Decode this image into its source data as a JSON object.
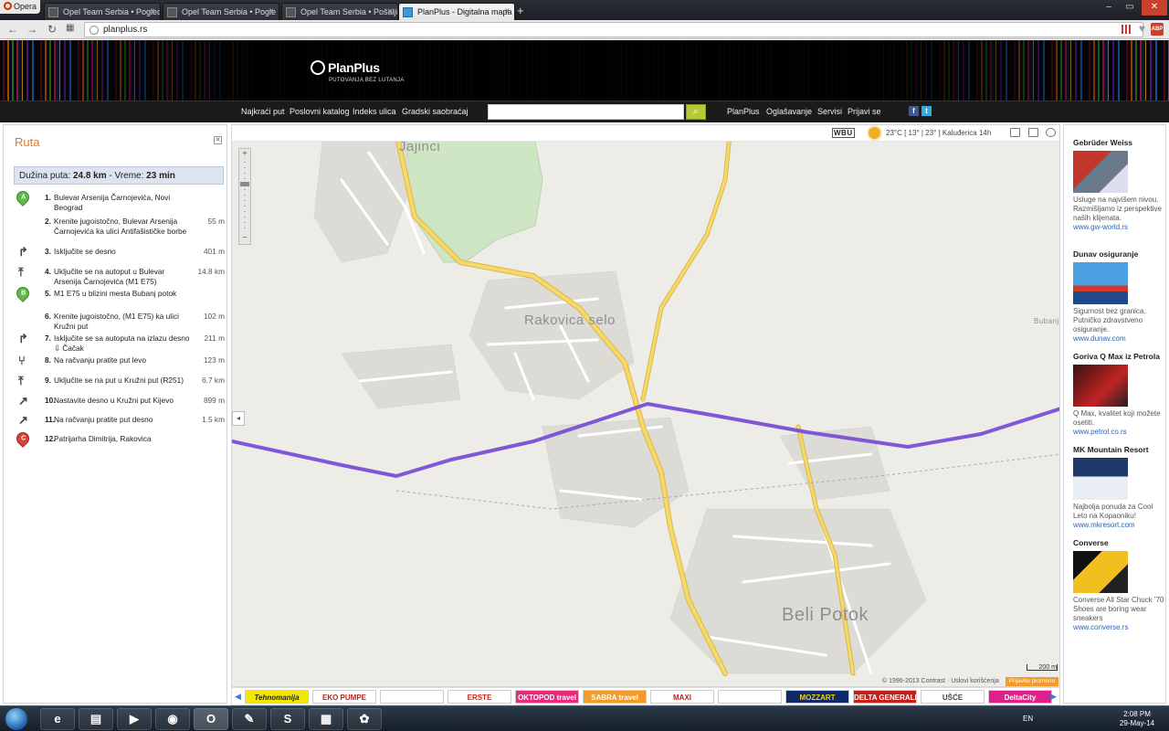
{
  "browser": {
    "menu_label": "Opera",
    "tabs": [
      {
        "label": "Opel Team Serbia • Poglec"
      },
      {
        "label": "Opel Team Serbia • Pogle"
      },
      {
        "label": "Opel Team Serbia • Pošalji"
      },
      {
        "label": "PlanPlus - Digitalna mapa"
      }
    ],
    "url": "planplus.rs",
    "adblock_label": "ABP"
  },
  "site": {
    "logo_name": "PlanPlus",
    "logo_tagline": "PUTOVANJA BEZ LUTANJA",
    "nav_left": [
      "Najkraći put",
      "Poslovni katalog",
      "Indeks ulica",
      "Gradski saobraćaj"
    ],
    "search_value": "",
    "nav_right": [
      "PlanPlus",
      "Oglašavanje",
      "Servisi",
      "Prijavi se"
    ]
  },
  "route": {
    "title": "Ruta",
    "summary_prefix": "Dužina puta:",
    "summary_length": "24.8 km",
    "summary_mid": "- Vreme:",
    "summary_time": "23 min",
    "steps": [
      {
        "num": "1.",
        "text": "Bulevar Arsenija Čarnojevića, Novi Beograd",
        "dist": "",
        "icon": "A"
      },
      {
        "num": "2.",
        "text": "Krenite jugoistočno, Bulevar Arsenija Čarnojevića ka ulici Antifašističke borbe",
        "dist": "55 m",
        "icon": ""
      },
      {
        "num": "3.",
        "text": "Isključite se desno",
        "dist": "401 m",
        "icon": "turn-right"
      },
      {
        "num": "4.",
        "text": "Uključite se na autoput u Bulevar Arsenija Čarnojevića (M1 E75)",
        "dist": "14.8 km",
        "icon": "merge"
      },
      {
        "num": "5.",
        "text": "M1 E75 u blizini mesta Bubanj potok",
        "dist": "",
        "icon": "B"
      },
      {
        "num": "6.",
        "text": "Krenite jugoistočno, (M1 E75) ka ulici Kružni put",
        "dist": "102 m",
        "icon": ""
      },
      {
        "num": "7.",
        "text": "Isključite se sa autoputa na izlazu desno ⇩ Čačak",
        "dist": "211 m",
        "icon": "turn-right"
      },
      {
        "num": "8.",
        "text": "Na račvanju pratite put levo",
        "dist": "123 m",
        "icon": "fork"
      },
      {
        "num": "9.",
        "text": "Uključite se na put u Kružni put (R251)",
        "dist": "6.7 km",
        "icon": "merge"
      },
      {
        "num": "10.",
        "text": "Nastavite desno u Kružni put Kijevo",
        "dist": "899 m",
        "icon": "bear-right"
      },
      {
        "num": "11.",
        "text": "Na račvanju pratite put desno",
        "dist": "1.5 km",
        "icon": "bear-right"
      },
      {
        "num": "12.",
        "text": "Patrijarha Dimitrija, Rakovica",
        "dist": "",
        "icon": "C"
      }
    ]
  },
  "map": {
    "weather_logo": "WBU",
    "weather_text": "23°C [ 13° | 23° ] Kaluđerica 14h",
    "labels": {
      "jajinci": "Jajinci",
      "rakovica_selo": "Rakovica selo",
      "beli_potok": "Beli Potok",
      "bubanj": "Bubanj"
    },
    "scale": "200 m",
    "copyright": "© 1996-2013 Contrast · Uslovi korišćenja",
    "report_label": "Prijavite promenu"
  },
  "banners": [
    "Tehnomanija",
    "EKO PUMPE",
    "",
    "ERSTE",
    "OKTOPOD travel",
    "SABRA travel",
    "MAXI",
    "",
    "MOZZART",
    "DELTA GENERALI",
    "UŠĆE",
    "DeltaCity"
  ],
  "ads": [
    {
      "title": "Gebrüder Weiss",
      "text": "Usluge na najvišem nivou. Razmišljamo iz perspektive naših klijenata.",
      "link": "www.gw-world.rs"
    },
    {
      "title": "Dunav osiguranje",
      "text": "Sigurnost bez granica. Putničko zdravstveno osiguranje.",
      "link": "www.dunav.com"
    },
    {
      "title": "Goriva Q Max iz Petrola",
      "text": "Q Max, kvalitet koji možete osetiti.",
      "link": "www.petrol.co.rs"
    },
    {
      "title": "MK Mountain Resort",
      "text": "Najbolja ponuda za Cool Leto na Kopaoniku!",
      "link": "www.mkresort.com"
    },
    {
      "title": "Converse",
      "text": "Converse All Star Chuck '70 Shoes are boring wear sneakers",
      "link": "www.converse.rs"
    }
  ],
  "taskbar": {
    "language": "EN",
    "time": "2:08 PM",
    "date": "29-May-14"
  }
}
